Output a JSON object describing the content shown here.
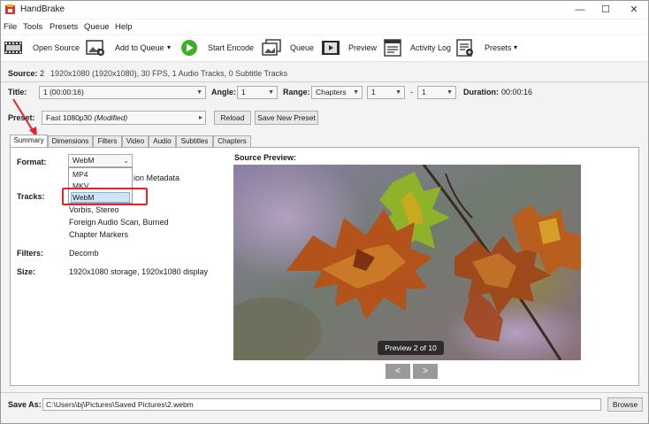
{
  "window": {
    "title": "HandBrake",
    "minimize": "—",
    "maximize": "☐",
    "close": "✕"
  },
  "menu": [
    "File",
    "Tools",
    "Presets",
    "Queue",
    "Help"
  ],
  "toolbar": {
    "open_source": "Open Source",
    "add_to_queue": "Add to Queue",
    "start_encode": "Start Encode",
    "queue": "Queue",
    "preview": "Preview",
    "activity_log": "Activity Log",
    "presets": "Presets",
    "dropdown_arrow": "▾"
  },
  "source": {
    "label": "Source:",
    "number": "2",
    "info": "1920x1080 (1920x1080), 30 FPS, 1 Audio Tracks, 0 Subtitle Tracks"
  },
  "title_row": {
    "title_label": "Title:",
    "title_value": "1 (00:00:16)",
    "angle_label": "Angle:",
    "angle_value": "1",
    "range_label": "Range:",
    "range_value": "Chapters",
    "range_start": "1",
    "range_dash": "-",
    "range_end": "1",
    "duration_label": "Duration:",
    "duration_value": "00:00:16"
  },
  "preset_row": {
    "label": "Preset:",
    "value": "Fast 1080p30",
    "modified": "(Modified)",
    "arrow": "▸",
    "reload": "Reload",
    "save_new": "Save New Preset"
  },
  "tabs": [
    "Summary",
    "Dimensions",
    "Filters",
    "Video",
    "Audio",
    "Subtitles",
    "Chapters"
  ],
  "summary": {
    "format_label": "Format:",
    "format_value": "WebM",
    "format_options": [
      "MP4",
      "MKV",
      "WebM"
    ],
    "metadata_partial": "ion Metadata",
    "tracks_label": "Tracks:",
    "tracks": [
      "Vorbis, Stereo",
      "Foreign Audio Scan, Burned",
      "Chapter Markers"
    ],
    "filters_label": "Filters:",
    "filters_value": "Decomb",
    "size_label": "Size:",
    "size_value": "1920x1080 storage, 1920x1080 display"
  },
  "source_preview": {
    "label": "Source Preview:",
    "badge": "Preview 2 of 10",
    "prev": "<",
    "next": ">"
  },
  "save_as": {
    "label": "Save As:",
    "path": "C:\\Users\\bj\\Pictures\\Saved Pictures\\2.webm",
    "browse": "Browse"
  },
  "colors": {
    "highlight": "#e8222a",
    "accent": "#0078d7",
    "play_green": "#3fae2a"
  },
  "icons": [
    "handbrake-logo",
    "film-icon",
    "add-image-icon",
    "play-icon",
    "images-icon",
    "film-strip-icon",
    "activity-log-icon",
    "presets-icon",
    "caret-down-icon"
  ]
}
